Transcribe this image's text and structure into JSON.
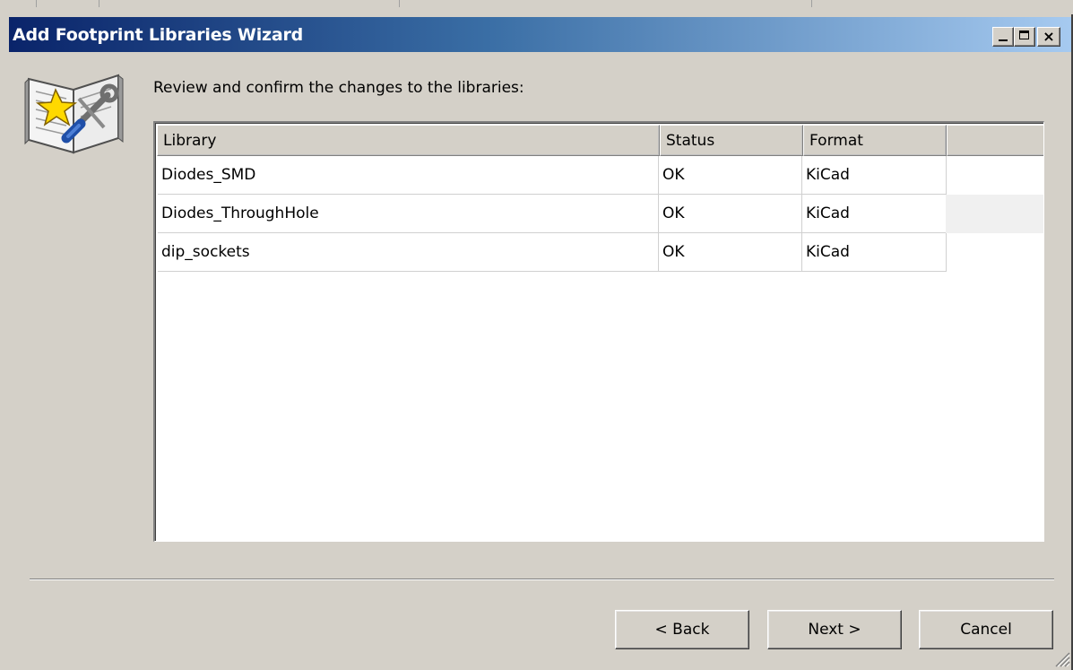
{
  "window": {
    "title": "Add Footprint Libraries Wizard",
    "controls": {
      "minimize": "minimize",
      "maximize": "maximize",
      "close": "×"
    }
  },
  "page": {
    "instruction": "Review and confirm the changes to the libraries:"
  },
  "table": {
    "columns": [
      "Library",
      "Status",
      "Format"
    ],
    "rows": [
      {
        "library": "Diodes_SMD",
        "status": "OK",
        "format": "KiCad"
      },
      {
        "library": "Diodes_ThroughHole",
        "status": "OK",
        "format": "KiCad"
      },
      {
        "library": "dip_sockets",
        "status": "OK",
        "format": "KiCad"
      }
    ]
  },
  "buttons": {
    "back": "< Back",
    "next": "Next >",
    "cancel": "Cancel"
  },
  "icons": {
    "wizard": "wizard-book-icon",
    "resize": "size-grip-icon"
  }
}
